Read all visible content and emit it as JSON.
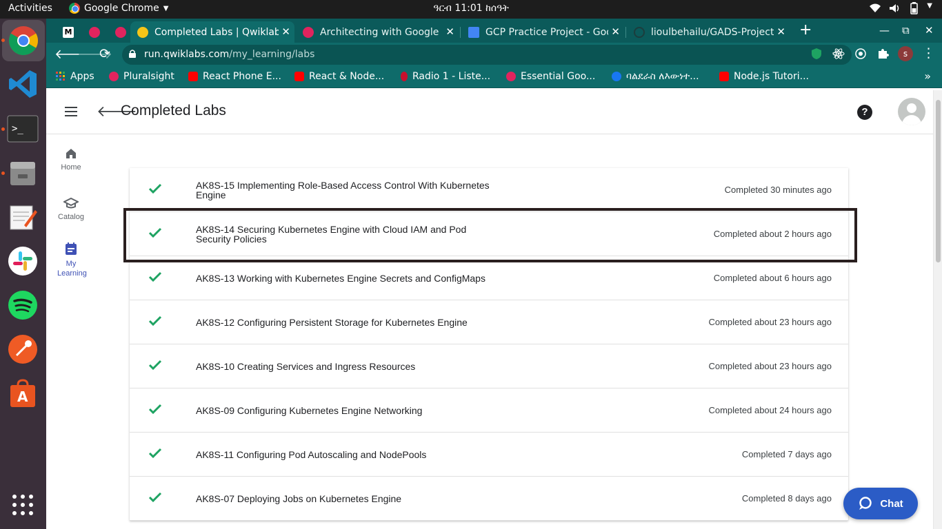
{
  "os": {
    "activities": "Activities",
    "app_name": "Google Chrome",
    "clock": "ዓርብ 11:01 ከሰዓት"
  },
  "browser": {
    "tabs": [
      {
        "label": "",
        "favicon": "medium-icon"
      },
      {
        "label": "",
        "favicon": "pluralsight-icon"
      },
      {
        "label": "",
        "favicon": "pluralsight-icon"
      },
      {
        "label": "Completed Labs | Qwiklabs",
        "favicon": "qwiklabs-icon"
      },
      {
        "label": "Architecting with Google",
        "favicon": "pluralsight-icon"
      },
      {
        "label": "GCP Practice Project - Goo",
        "favicon": "google-docs-icon"
      },
      {
        "label": "lioulbehailu/GADS-Project",
        "favicon": "github-icon"
      }
    ],
    "url_host": "run.qwiklabs.com",
    "url_path": "/my_learning/labs",
    "profile_initial": "s",
    "bookmarks": [
      {
        "label": "Apps",
        "icon": "apps-grid-icon"
      },
      {
        "label": "Pluralsight",
        "icon": "pluralsight-icon"
      },
      {
        "label": "React Phone E...",
        "icon": "youtube-icon"
      },
      {
        "label": "React & Node...",
        "icon": "youtube-icon"
      },
      {
        "label": "Radio 1 - Liste...",
        "icon": "radio-icon"
      },
      {
        "label": "Essential Goo...",
        "icon": "pluralsight-icon"
      },
      {
        "label": "ባልደራስ ለእውነተ...",
        "icon": "facebook-icon"
      },
      {
        "label": "Node.js Tutori...",
        "icon": "youtube-icon"
      }
    ]
  },
  "page": {
    "title": "Completed Labs",
    "sidenav": [
      {
        "label": "Home",
        "icon": "home-icon"
      },
      {
        "label": "Catalog",
        "icon": "catalog-icon"
      },
      {
        "label": "My Learning",
        "icon": "my-learning-icon"
      }
    ],
    "labs": [
      {
        "title": "AK8S-15 Implementing Role-Based Access Control With Kubernetes Engine",
        "status": "Completed 30 minutes ago"
      },
      {
        "title": "AK8S-14 Securing Kubernetes Engine with Cloud IAM and Pod Security Policies",
        "status": "Completed about 2 hours ago"
      },
      {
        "title": "AK8S-13 Working with Kubernetes Engine Secrets and ConfigMaps",
        "status": "Completed about 6 hours ago"
      },
      {
        "title": "AK8S-12 Configuring Persistent Storage for Kubernetes Engine",
        "status": "Completed about 23 hours ago"
      },
      {
        "title": "AK8S-10 Creating Services and Ingress Resources",
        "status": "Completed about 23 hours ago"
      },
      {
        "title": "AK8S-09 Configuring Kubernetes Engine Networking",
        "status": "Completed about 24 hours ago"
      },
      {
        "title": "AK8S-11 Configuring Pod Autoscaling and NodePools",
        "status": "Completed 7 days ago"
      },
      {
        "title": "AK8S-07 Deploying Jobs on Kubernetes Engine",
        "status": "Completed 8 days ago"
      }
    ],
    "chat_label": "Chat"
  },
  "colors": {
    "chrome_frame": "#0b5a5a",
    "check_green": "#1ea362",
    "nav_active": "#3f51b5",
    "chat_blue": "#2b5cc6"
  }
}
